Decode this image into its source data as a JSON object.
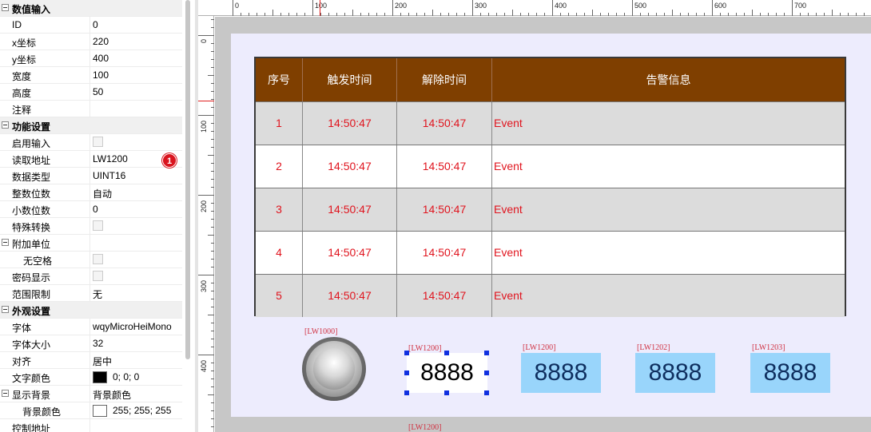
{
  "properties": {
    "sections": {
      "value_input": "数值输入",
      "function_settings": "功能设置",
      "appearance_settings": "外观设置"
    },
    "rows": {
      "id": {
        "name": "ID",
        "value": "0"
      },
      "x": {
        "name": "x坐标",
        "value": "220"
      },
      "y": {
        "name": "y坐标",
        "value": "400"
      },
      "width": {
        "name": "宽度",
        "value": "100"
      },
      "height": {
        "name": "高度",
        "value": "50"
      },
      "comment": {
        "name": "注释",
        "value": ""
      },
      "enable_input": {
        "name": "启用输入"
      },
      "read_address": {
        "name": "读取地址",
        "value": "LW1200"
      },
      "data_type": {
        "name": "数据类型",
        "value": "UINT16"
      },
      "integer_digits": {
        "name": "整数位数",
        "value": "自动"
      },
      "decimal_digits": {
        "name": "小数位数",
        "value": "0"
      },
      "special_conversion": {
        "name": "特殊转换"
      },
      "extra_unit": {
        "name": "附加单位"
      },
      "no_space": {
        "name": "无空格"
      },
      "password_display": {
        "name": "密码显示"
      },
      "range_limit": {
        "name": "范围限制",
        "value": "无"
      },
      "font": {
        "name": "字体",
        "value": "wqyMicroHeiMono"
      },
      "font_size": {
        "name": "字体大小",
        "value": "32"
      },
      "align": {
        "name": "对齐",
        "value": "居中"
      },
      "text_color": {
        "name": "文字颜色",
        "value": "0; 0; 0",
        "color": "#000000"
      },
      "show_background": {
        "name": "显示背景",
        "value": "背景颜色"
      },
      "background_color": {
        "name": "背景颜色",
        "value": "255; 255; 255",
        "color": "#ffffff"
      },
      "control_address": {
        "name": "控制地址",
        "value": ""
      }
    },
    "badge": "1"
  },
  "ruler": {
    "top_labels": [
      "0",
      "100",
      "200",
      "300",
      "400",
      "500",
      "600",
      "700"
    ],
    "left_labels": [
      "0",
      "100",
      "200",
      "300",
      "400"
    ]
  },
  "alarm_table": {
    "headers": [
      "序号",
      "触发时间",
      "解除时间",
      "告警信息"
    ],
    "rows": [
      [
        "1",
        "14:50:47",
        "14:50:47",
        "Event"
      ],
      [
        "2",
        "14:50:47",
        "14:50:47",
        "Event"
      ],
      [
        "3",
        "14:50:47",
        "14:50:47",
        "Event"
      ],
      [
        "4",
        "14:50:47",
        "14:50:47",
        "Event"
      ],
      [
        "5",
        "14:50:47",
        "14:50:47",
        "Event"
      ]
    ]
  },
  "widgets": {
    "lamp_label": "[LW1000]",
    "selected_label": "[LW1200]",
    "selected_value": "8888",
    "selected_label_bottom": "[LW1200]",
    "box1_label": "[LW1200]",
    "box1_value": "8888",
    "box2_label": "[LW1202]",
    "box2_value": "8888",
    "box3_label": "[LW1203]",
    "box3_value": "8888"
  },
  "colors": {
    "table_header": "#7f3f00",
    "alarm_text": "#e0141e",
    "numeric_box": "#99d5fb",
    "screen_bg": "#edecfd",
    "selection_handle": "#1030e0",
    "badge": "#d9141e"
  }
}
